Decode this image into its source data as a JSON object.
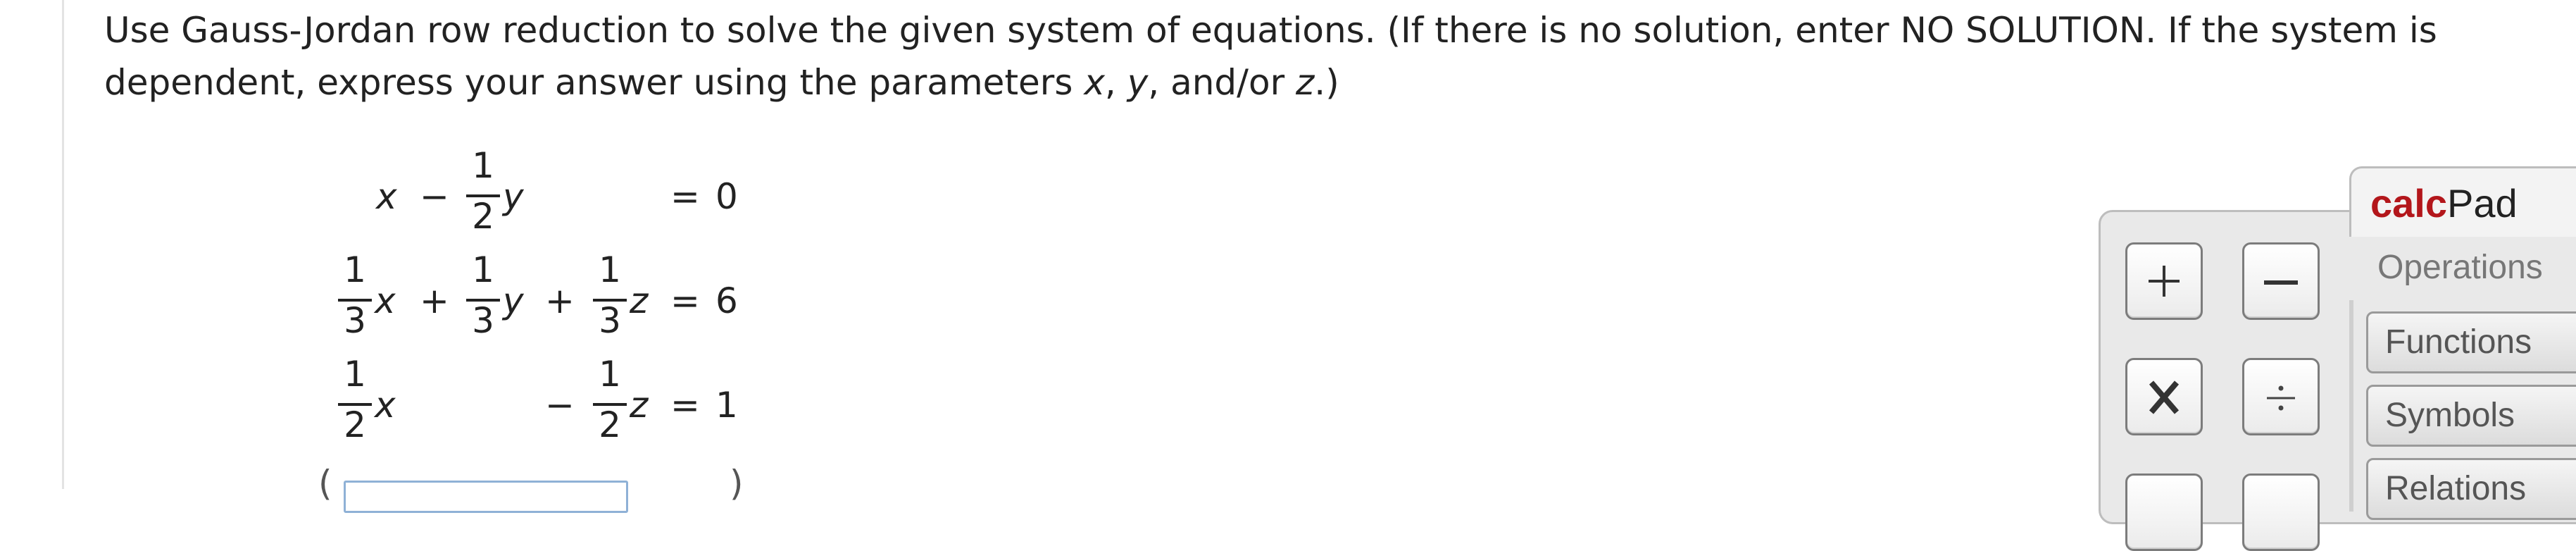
{
  "question": {
    "part1": "Use Gauss-Jordan row reduction to solve the given system of equations. (If there is no solution, enter NO SOLUTION. If the system is dependent, express your answer using the parameters ",
    "param_x": "x",
    "sep1": ", ",
    "param_y": "y",
    "sep2": ", and/or ",
    "param_z": "z",
    "part2": ".)"
  },
  "system": {
    "eq1": {
      "x": "x",
      "minus": "−",
      "f_num": "1",
      "f_den": "2",
      "y": "y",
      "eq": "=",
      "rhs": "0"
    },
    "eq2": {
      "fx_num": "1",
      "fx_den": "3",
      "x": "x",
      "plus1": "+",
      "fy_num": "1",
      "fy_den": "3",
      "y": "y",
      "plus2": "+",
      "fz_num": "1",
      "fz_den": "3",
      "z": "z",
      "eq": "=",
      "rhs": "6"
    },
    "eq3": {
      "fx_num": "1",
      "fx_den": "2",
      "x": "x",
      "minus": "−",
      "fz_num": "1",
      "fz_den": "2",
      "z": "z",
      "eq": "=",
      "rhs": "1"
    }
  },
  "answer": {
    "open": "(",
    "close": ")"
  },
  "calcpad": {
    "title_bold": "calc",
    "title_plain": "Pad",
    "tabs": [
      "Operations",
      "Functions",
      "Symbols",
      "Relations"
    ],
    "keys": [
      "plus-key",
      "minus-key",
      "times-key",
      "divide-key"
    ],
    "colors": {
      "brand": "#b3161b",
      "panel": "#e9e9e9"
    }
  }
}
